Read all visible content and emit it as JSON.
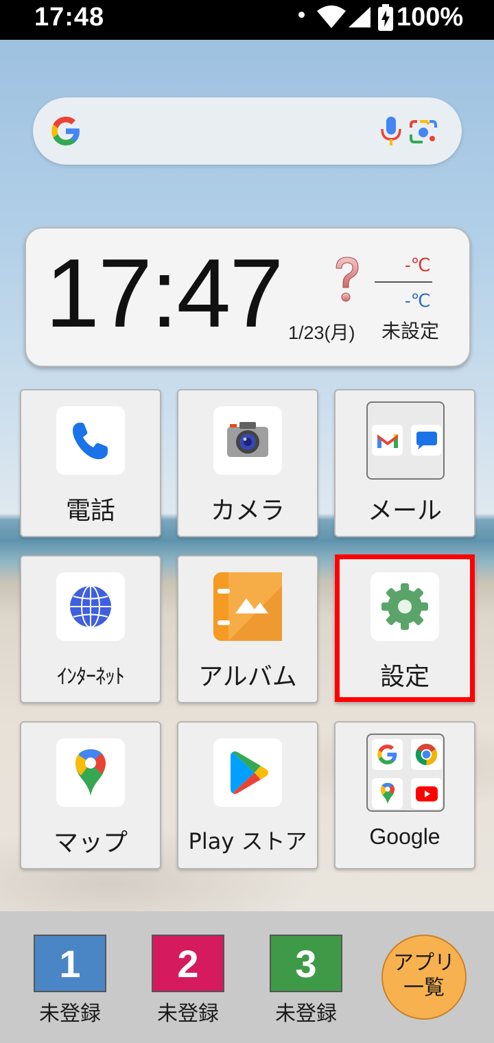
{
  "status_bar": {
    "time": "17:48",
    "battery": "100%",
    "icons": [
      "notification-dot-icon",
      "wifi-icon",
      "signal-icon",
      "battery-charging-icon"
    ]
  },
  "search": {
    "icons": [
      "google-g-icon",
      "mic-icon",
      "google-lens-icon"
    ]
  },
  "clock_widget": {
    "time": "17:47",
    "date": "1/23(月)",
    "temp_high": "-℃",
    "temp_low": "-℃",
    "location": "未設定",
    "weather_icon": "question-mark-icon"
  },
  "apps": [
    {
      "label": "電話",
      "icon": "phone-icon"
    },
    {
      "label": "カメラ",
      "icon": "camera-icon"
    },
    {
      "label": "メール",
      "icon": "mail-folder-icon",
      "contents": [
        "gmail-icon",
        "messages-icon"
      ]
    },
    {
      "label": "ｲﾝﾀｰﾈｯﾄ",
      "icon": "globe-icon"
    },
    {
      "label": "アルバム",
      "icon": "album-icon"
    },
    {
      "label": "設定",
      "icon": "gear-icon",
      "highlighted": true
    },
    {
      "label": "マップ",
      "icon": "maps-pin-icon"
    },
    {
      "label": "Play ストア",
      "icon": "play-store-icon"
    },
    {
      "label": "Google",
      "icon": "google-folder-icon",
      "contents": [
        "google-g-icon",
        "chrome-icon",
        "maps-icon",
        "youtube-icon"
      ]
    }
  ],
  "dock": {
    "speed_dial": [
      {
        "number": "1",
        "label": "未登録",
        "color": "#4a86c5"
      },
      {
        "number": "2",
        "label": "未登録",
        "color": "#d61a5e"
      },
      {
        "number": "3",
        "label": "未登録",
        "color": "#3f9a48"
      }
    ],
    "apps_button": {
      "line1": "アプリ",
      "line2": "一覧",
      "color": "#f7b24f"
    }
  },
  "colors": {
    "highlight": "#ff0000",
    "temp_high": "#d93232",
    "temp_low": "#2c68c8"
  }
}
